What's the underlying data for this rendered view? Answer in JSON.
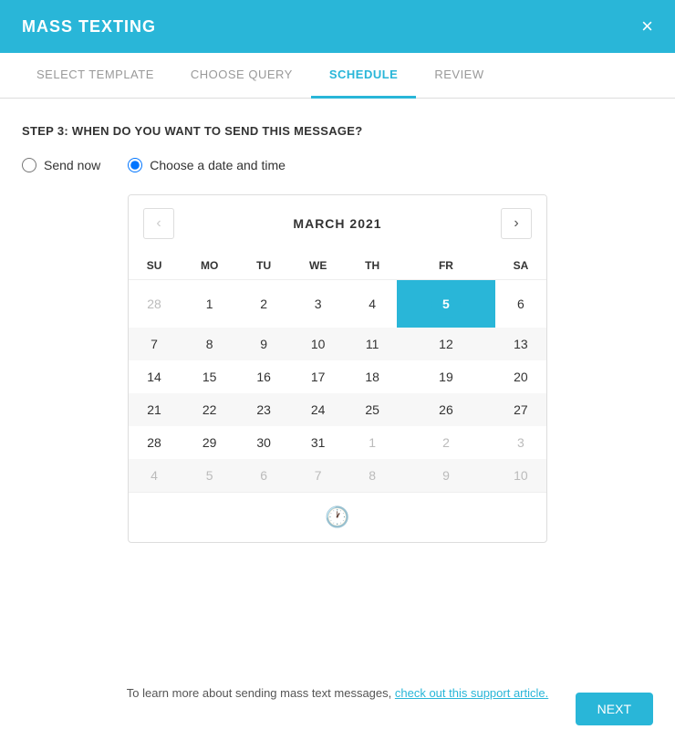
{
  "header": {
    "title": "MASS TEXTING",
    "close_label": "×"
  },
  "tabs": [
    {
      "id": "select-template",
      "label": "SELECT TEMPLATE",
      "active": false
    },
    {
      "id": "choose-query",
      "label": "CHOOSE QUERY",
      "active": false
    },
    {
      "id": "schedule",
      "label": "SCHEDULE",
      "active": true
    },
    {
      "id": "review",
      "label": "REVIEW",
      "active": false
    }
  ],
  "step": {
    "title": "STEP 3: WHEN DO YOU WANT TO SEND THIS MESSAGE?"
  },
  "radio_options": [
    {
      "id": "send-now",
      "label": "Send now",
      "checked": false
    },
    {
      "id": "choose-date",
      "label": "Choose a date and time",
      "checked": true
    }
  ],
  "calendar": {
    "month_year": "MARCH 2021",
    "days_of_week": [
      "SU",
      "MO",
      "TU",
      "WE",
      "TH",
      "FR",
      "SA"
    ],
    "weeks": [
      [
        {
          "day": 28,
          "other": true
        },
        {
          "day": 1,
          "other": false
        },
        {
          "day": 2,
          "other": false
        },
        {
          "day": 3,
          "other": false
        },
        {
          "day": 4,
          "other": false
        },
        {
          "day": 5,
          "other": false,
          "selected": true
        },
        {
          "day": 6,
          "other": false
        }
      ],
      [
        {
          "day": 7,
          "other": false
        },
        {
          "day": 8,
          "other": false
        },
        {
          "day": 9,
          "other": false
        },
        {
          "day": 10,
          "other": false
        },
        {
          "day": 11,
          "other": false
        },
        {
          "day": 12,
          "other": false
        },
        {
          "day": 13,
          "other": false
        }
      ],
      [
        {
          "day": 14,
          "other": false
        },
        {
          "day": 15,
          "other": false
        },
        {
          "day": 16,
          "other": false
        },
        {
          "day": 17,
          "other": false
        },
        {
          "day": 18,
          "other": false
        },
        {
          "day": 19,
          "other": false
        },
        {
          "day": 20,
          "other": false
        }
      ],
      [
        {
          "day": 21,
          "other": false
        },
        {
          "day": 22,
          "other": false
        },
        {
          "day": 23,
          "other": false
        },
        {
          "day": 24,
          "other": false
        },
        {
          "day": 25,
          "other": false
        },
        {
          "day": 26,
          "other": false
        },
        {
          "day": 27,
          "other": false
        }
      ],
      [
        {
          "day": 28,
          "other": false
        },
        {
          "day": 29,
          "other": false
        },
        {
          "day": 30,
          "other": false
        },
        {
          "day": 31,
          "other": false
        },
        {
          "day": 1,
          "other": true
        },
        {
          "day": 2,
          "other": true
        },
        {
          "day": 3,
          "other": true
        }
      ],
      [
        {
          "day": 4,
          "other": true
        },
        {
          "day": 5,
          "other": true
        },
        {
          "day": 6,
          "other": true
        },
        {
          "day": 7,
          "other": true
        },
        {
          "day": 8,
          "other": true
        },
        {
          "day": 9,
          "other": true
        },
        {
          "day": 10,
          "other": true
        }
      ]
    ],
    "nav_prev": "‹",
    "nav_next": "›"
  },
  "footer": {
    "text": "To learn more about sending mass text messages,",
    "link_text": "check out this support article.",
    "link_url": "#"
  },
  "next_button": "NEXT"
}
